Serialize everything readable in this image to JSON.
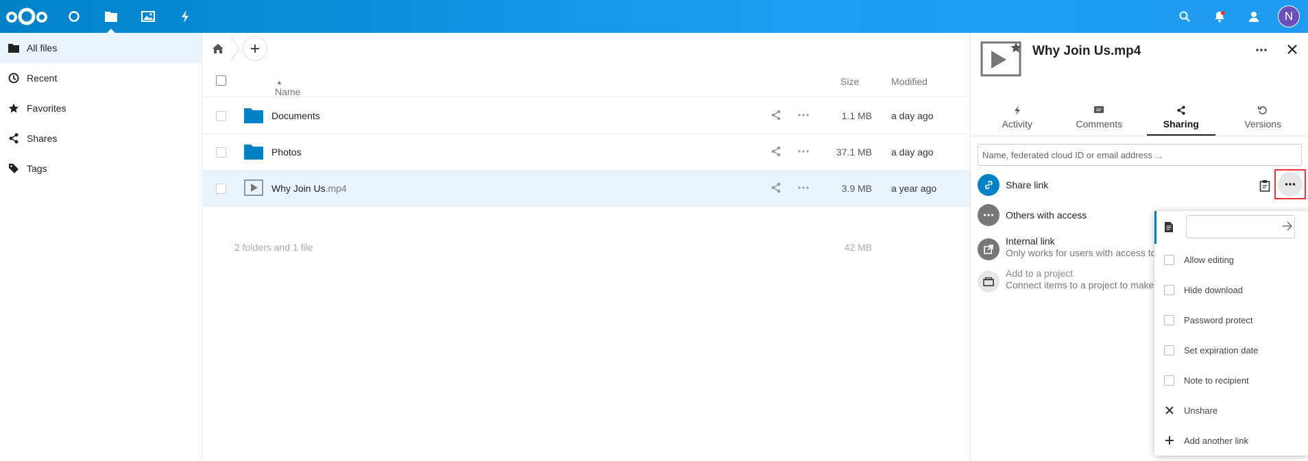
{
  "header": {
    "apps": [
      "logo-icon",
      "dashboard-icon",
      "files-icon",
      "photos-icon",
      "activity-icon"
    ],
    "right_icons": [
      "search-icon",
      "notifications-icon",
      "contacts-icon"
    ],
    "avatar_letter": "N",
    "colors": {
      "header_start": "#0082c9",
      "header_end": "#1e9cf0",
      "avatar": "#6a4fb8"
    }
  },
  "nav": {
    "items": [
      {
        "label": "All files",
        "icon": "folder-icon",
        "active": true
      },
      {
        "label": "Recent",
        "icon": "clock-icon"
      },
      {
        "label": "Favorites",
        "icon": "star-icon"
      },
      {
        "label": "Shares",
        "icon": "share-icon"
      },
      {
        "label": "Tags",
        "icon": "tag-icon"
      }
    ]
  },
  "files": {
    "columns": {
      "name": "Name",
      "size": "Size",
      "modified": "Modified"
    },
    "rows": [
      {
        "name": "Documents",
        "ext": "",
        "size": "1.1 MB",
        "modified": "a day ago",
        "type": "folder"
      },
      {
        "name": "Photos",
        "ext": "",
        "size": "37.1 MB",
        "modified": "a day ago",
        "type": "folder"
      },
      {
        "name": "Why Join Us",
        "ext": ".mp4",
        "size": "3.9 MB",
        "modified": "a year ago",
        "type": "video",
        "selected": true
      }
    ],
    "summary": {
      "label": "2 folders and 1 file",
      "size": "42 MB"
    }
  },
  "sidebar": {
    "title": "Why Join Us.mp4",
    "tabs": [
      {
        "label": "Activity",
        "icon": "activity-icon"
      },
      {
        "label": "Comments",
        "icon": "comment-icon"
      },
      {
        "label": "Sharing",
        "icon": "share-icon",
        "active": true
      },
      {
        "label": "Versions",
        "icon": "history-icon"
      }
    ],
    "search_placeholder": "Name, federated cloud ID or email address ...",
    "share_link": "Share link",
    "others_access": "Others with access",
    "internal_link": "Internal link",
    "internal_sub": "Only works for users with access to",
    "project_label": "Add to a project",
    "project_sub": "Connect items to a project to make"
  },
  "menu": {
    "items": [
      {
        "label": "Allow editing",
        "type": "checkbox"
      },
      {
        "label": "Hide download",
        "type": "checkbox"
      },
      {
        "label": "Password protect",
        "type": "checkbox"
      },
      {
        "label": "Set expiration date",
        "type": "checkbox"
      },
      {
        "label": "Note to recipient",
        "type": "checkbox"
      },
      {
        "label": "Unshare",
        "type": "close-icon"
      },
      {
        "label": "Add another link",
        "type": "plus-icon"
      }
    ]
  }
}
